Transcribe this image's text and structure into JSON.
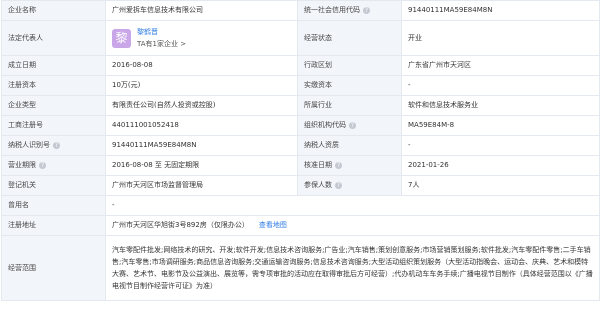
{
  "rows": {
    "company_name": {
      "label": "企业名称",
      "value": "广州爱拆车信息技术有限公司"
    },
    "credit_code": {
      "label": "统一社会信用代码",
      "value": "91440111MA59E84M8N"
    },
    "legal_rep": {
      "label": "法定代表人",
      "avatar_char": "黎",
      "name": "黎鹤晋",
      "sub": "TA有1家企业 >"
    },
    "status": {
      "label": "经营状态",
      "value": "开业"
    },
    "founded": {
      "label": "成立日期",
      "value": "2016-08-08"
    },
    "region": {
      "label": "行政区划",
      "value": "广东省广州市天河区"
    },
    "reg_capital": {
      "label": "注册资本",
      "value": "10万(元)"
    },
    "paid_capital": {
      "label": "实缴资本",
      "value": "-"
    },
    "company_type": {
      "label": "企业类型",
      "value": "有限责任公司(自然人投资或控股)"
    },
    "industry": {
      "label": "所属行业",
      "value": "软件和信息技术服务业"
    },
    "reg_number": {
      "label": "工商注册号",
      "value": "440111001052418"
    },
    "org_code": {
      "label": "组织机构代码",
      "value": "MA59E84M-8"
    },
    "taxpayer_id": {
      "label": "纳税人识别号",
      "value": "91440111MA59E84M8N"
    },
    "taxpayer_quality": {
      "label": "纳税人资质",
      "value": "-"
    },
    "business_term": {
      "label": "营业期限",
      "value": "2016-08-08 至 无固定期限"
    },
    "approval_date": {
      "label": "核准日期",
      "value": "2021-01-26"
    },
    "authority": {
      "label": "登记机关",
      "value": "广州市天河区市场监督管理局"
    },
    "insured": {
      "label": "参保人数",
      "value": "7人"
    },
    "former_name": {
      "label": "曾用名",
      "value": "-"
    },
    "address": {
      "label": "注册地址",
      "value": "广州市天河区华旭街3号892房（仅限办公）",
      "link": "查看地图"
    },
    "scope": {
      "label": "经营范围",
      "value": "汽车零配件批发;网络技术的研究、开发;软件开发;信息技术咨询服务;广告业;汽车销售;策划创意服务;市场营销策划服务;软件批发;汽车零配件零售;二手车销售;汽车零售;市场调研服务;商品信息咨询服务;交通运输咨询服务;信息技术咨询服务;大型活动组织策划服务（大型活动指晚会、运动会、庆典、艺术和模特大赛、艺术节、电影节及公益演出、展览等，需专项审批的活动应在取得审批后方可经营）;代办机动车车务手续;广播电视节目制作（具体经营范围以《广播电视节目制作经营许可证》为准）"
    }
  }
}
